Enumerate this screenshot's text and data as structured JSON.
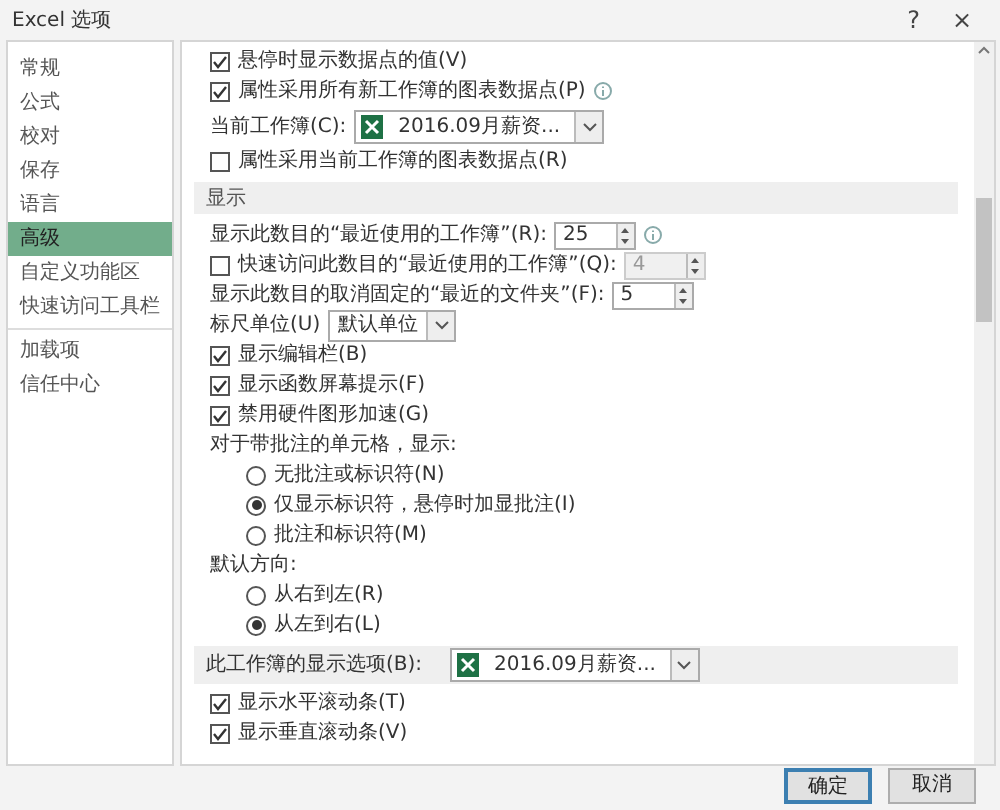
{
  "window": {
    "title": "Excel 选项",
    "help_button": "?",
    "close_button": "×"
  },
  "sidebar": {
    "groups": [
      [
        {
          "label": "常规",
          "selected": false
        },
        {
          "label": "公式",
          "selected": false
        },
        {
          "label": "校对",
          "selected": false
        },
        {
          "label": "保存",
          "selected": false
        },
        {
          "label": "语言",
          "selected": false
        },
        {
          "label": "高级",
          "selected": true
        },
        {
          "label": "自定义功能区",
          "selected": false
        },
        {
          "label": "快速访问工具栏",
          "selected": false
        }
      ],
      [
        {
          "label": "加载项",
          "selected": false
        },
        {
          "label": "信任中心",
          "selected": false
        }
      ]
    ]
  },
  "content": {
    "rows": [
      {
        "kind": "checkbox",
        "label": "悬停时显示数据点的值(V)",
        "checked": true
      },
      {
        "kind": "checkbox",
        "label": "属性采用所有新工作簿的图表数据点(P)",
        "checked": true,
        "info_icon": true
      },
      {
        "kind": "workbook",
        "label": "当前工作簿(C):",
        "value": "2016.09月薪资..."
      },
      {
        "kind": "checkbox",
        "label": "属性采用当前工作簿的图表数据点(R)",
        "checked": false
      },
      {
        "kind": "section",
        "label": "显示"
      },
      {
        "kind": "spinner",
        "label": "显示此数目的“最近使用的工作簿”(R):",
        "value": "25",
        "disabled": false,
        "info_icon": true
      },
      {
        "kind": "check-spinner",
        "label": "快速访问此数目的“最近使用的工作簿”(Q):",
        "checked": false,
        "value": "4",
        "disabled": true
      },
      {
        "kind": "spinner",
        "label": "显示此数目的取消固定的“最近的文件夹”(F):",
        "value": "5",
        "disabled": false
      },
      {
        "kind": "select",
        "label": "标尺单位(U)",
        "value": "默认单位"
      },
      {
        "kind": "checkbox",
        "label": "显示编辑栏(B)",
        "checked": true
      },
      {
        "kind": "checkbox",
        "label": "显示函数屏幕提示(F)",
        "checked": true
      },
      {
        "kind": "checkbox",
        "label": "禁用硬件图形加速(G)",
        "checked": true
      },
      {
        "kind": "heading",
        "label": "对于带批注的单元格，显示:"
      },
      {
        "kind": "radio",
        "label": "无批注或标识符(N)",
        "selected": false
      },
      {
        "kind": "radio",
        "label": "仅显示标识符，悬停时加显批注(I)",
        "selected": true
      },
      {
        "kind": "radio",
        "label": "批注和标识符(M)",
        "selected": false
      },
      {
        "kind": "heading",
        "label": "默认方向:"
      },
      {
        "kind": "radio",
        "label": "从右到左(R)",
        "selected": false
      },
      {
        "kind": "radio",
        "label": "从左到右(L)",
        "selected": true
      },
      {
        "kind": "section-workbook",
        "label": "此工作簿的显示选项(B):",
        "value": "2016.09月薪资..."
      },
      {
        "kind": "checkbox",
        "label": "显示水平滚动条(T)",
        "checked": true
      },
      {
        "kind": "checkbox",
        "label": "显示垂直滚动条(V)",
        "checked": true
      }
    ]
  },
  "buttons": [
    {
      "label": "确定",
      "default": true
    },
    {
      "label": "取消",
      "default": false
    }
  ]
}
